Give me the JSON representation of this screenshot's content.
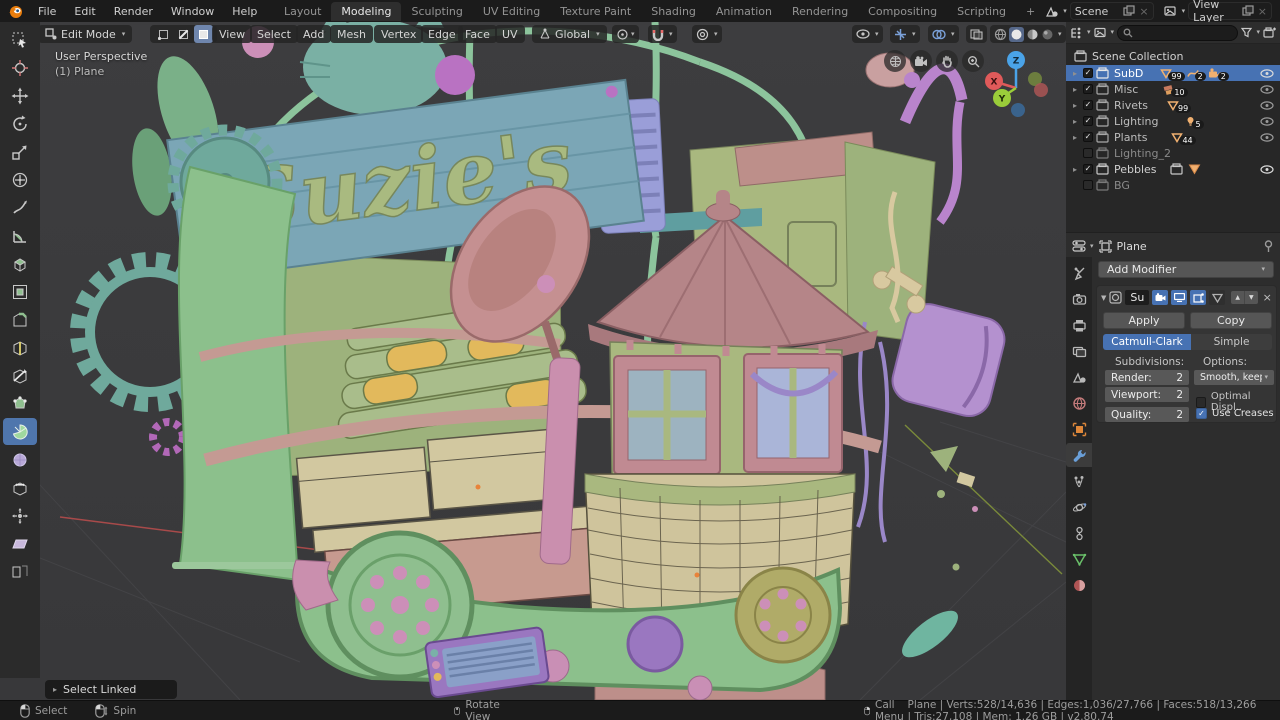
{
  "icons": {
    "chevron_down": "▾",
    "expand_arrow": "▸",
    "panel_open": "▼",
    "check": "✓",
    "close": "×",
    "up": "▲",
    "down": "▼",
    "add": "+"
  },
  "topbar": {
    "menus": [
      "File",
      "Edit",
      "Render",
      "Window",
      "Help"
    ],
    "workspaces": [
      "Layout",
      "Modeling",
      "Sculpting",
      "UV Editing",
      "Texture Paint",
      "Shading",
      "Animation",
      "Rendering",
      "Compositing",
      "Scripting"
    ],
    "active_workspace": "Modeling",
    "scene": {
      "label": "Scene"
    },
    "view_layer": {
      "label": "View Layer"
    }
  },
  "viewport_header": {
    "mode": "Edit Mode",
    "menus": [
      "View",
      "Select",
      "Add",
      "Mesh"
    ],
    "mesh_menus": [
      "Vertex",
      "Edge",
      "Face",
      "UV"
    ],
    "orientation": "Global"
  },
  "toolbar": {
    "active_tool": "spin",
    "tools": [
      "select-box",
      "cursor",
      "move",
      "rotate",
      "scale",
      "transform",
      "annotate",
      "measure",
      "extrude-region",
      "inset-faces",
      "bevel",
      "loop-cut",
      "knife",
      "poly-build",
      "spin",
      "smooth",
      "edge-slide",
      "shrink-fatten",
      "shear",
      "rip-region"
    ]
  },
  "viewport": {
    "perspective_label": "User Perspective",
    "object_label": "(1) Plane",
    "sign_text": "Suzie's",
    "axis": {
      "x": "X",
      "y": "Y",
      "z": "Z"
    },
    "operator_panel": "Select Linked"
  },
  "outliner": {
    "root": "Scene Collection",
    "items": [
      {
        "name": "SubD",
        "checked": true,
        "selected": true,
        "badges": [
          {
            "icon": "mesh-data",
            "count": "99"
          },
          {
            "icon": "curve-data",
            "count": "2"
          },
          {
            "icon": "camera-data",
            "count": "2"
          }
        ],
        "eye": true
      },
      {
        "name": "Misc",
        "checked": true,
        "badges": [
          {
            "icon": "misc-data",
            "count": "10"
          }
        ],
        "eye": true
      },
      {
        "name": "Rivets",
        "checked": true,
        "badges": [
          {
            "icon": "mesh-data",
            "count": "99"
          }
        ],
        "eye": true
      },
      {
        "name": "Lighting",
        "checked": true,
        "badges": [
          {
            "icon": "light-data",
            "count": "5"
          }
        ],
        "eye": true
      },
      {
        "name": "Plants",
        "checked": true,
        "badges": [
          {
            "icon": "mesh-data",
            "count": "44"
          }
        ],
        "eye": true
      },
      {
        "name": "Lighting_2",
        "checked": false,
        "badges": [],
        "eye": false
      },
      {
        "name": "Pebbles",
        "checked": true,
        "badges": [
          {
            "icon": "collection"
          },
          {
            "icon": "mesh-data"
          }
        ],
        "eye": true
      },
      {
        "name": "BG",
        "checked": false,
        "badges": [],
        "eye": false
      }
    ]
  },
  "properties": {
    "tabs": [
      "tool",
      "render",
      "output",
      "view-layer",
      "scene",
      "world",
      "object",
      "modifiers",
      "particles",
      "physics",
      "constraints",
      "data",
      "material"
    ],
    "active_tab": "modifiers",
    "breadcrumb": "Plane",
    "add_modifier": "Add Modifier",
    "modifier": {
      "name": "Su",
      "apply": "Apply",
      "copy": "Copy",
      "type_catmull": "Catmull-Clark",
      "type_simple": "Simple",
      "subdivisions_label": "Subdivisions:",
      "render_label": "Render:",
      "render_value": "2",
      "viewport_label": "Viewport:",
      "viewport_value": "2",
      "quality_label": "Quality:",
      "quality_value": "2",
      "options_label": "Options:",
      "uv_smooth": "Smooth, keep c..",
      "optimal_display": "Optimal Displ..",
      "use_creases": "Use Creases"
    }
  },
  "status_bar": {
    "hints": [
      {
        "button": "left-mouse",
        "label": "Select"
      },
      {
        "button": "left-mouse-drag",
        "label": "Spin"
      },
      {
        "button": "middle-mouse",
        "label": "Rotate View"
      },
      {
        "button": "right-mouse",
        "label": "Call Menu"
      }
    ],
    "stats": "Plane | Verts:528/14,636 | Edges:1,036/27,766 | Faces:518/13,266 | Tris:27,108 | Mem: 1.26 GB | v2.80.74"
  },
  "colors": {
    "accent": "#4772b3",
    "selected_row": "#4772b3",
    "orange_data": "#dd9e5e",
    "viewport_bg": "#3a3a3c"
  }
}
